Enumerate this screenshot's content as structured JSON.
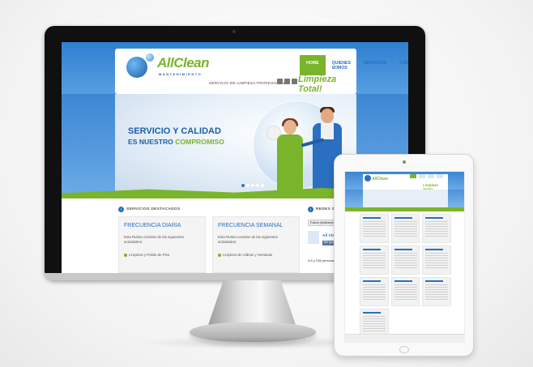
{
  "site": {
    "brand": "AllClean",
    "brand_sub": "MANTENIMIENTO",
    "tagline": "SERVICIO DE LIMPIEZA PROFESIONAL",
    "slogan": "Limpieza Total!",
    "nav": [
      {
        "label": "HOME",
        "active": true
      },
      {
        "label": "QUIENES SOMOS",
        "active": false
      },
      {
        "label": "SERVICIOS",
        "active": false
      },
      {
        "label": "CONTACTO",
        "active": false
      }
    ],
    "banner": {
      "headline_line1": "SERVICIO Y CALIDAD",
      "headline_line2_a": "ES NUESTRO",
      "headline_line2_b": "COMPROMISO",
      "slides": 5,
      "active_slide": 1
    },
    "sections": {
      "featured_title": "SERVICIOS DESTACADOS",
      "social_title": "REDES SOCIALES"
    },
    "cards": [
      {
        "title": "FRECUENCIA DIARIA",
        "desc": "Esta Rutina consiste de las siguientes actividades:",
        "item": "Limpieza y Pulido de Piso"
      },
      {
        "title": "FRECUENCIA SEMANAL",
        "desc": "Esta Rutina consiste de las siguientes actividades:",
        "item": "Limpieza de Vidrios y Ventanas"
      }
    ],
    "social": {
      "twitter_button": "Follow @allclean",
      "facebook_name": "All Clean",
      "facebook_like": "Me gusta",
      "facebook_count": "A 6 y 236 personas..."
    }
  },
  "colors": {
    "primary_blue": "#2a6fbf",
    "accent_green": "#7ab42a"
  }
}
